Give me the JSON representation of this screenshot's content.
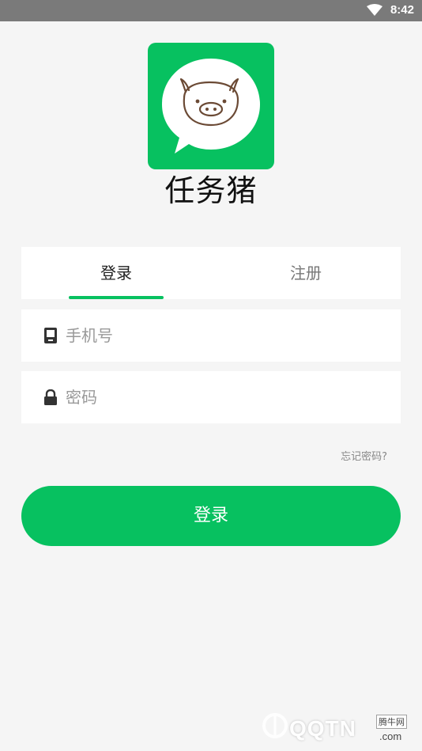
{
  "status_bar": {
    "time": "8:42",
    "icons": [
      "wifi-icon"
    ],
    "background_color": "#7a7a7a"
  },
  "app": {
    "name": "任务猪",
    "logo_icon": "pig-face-icon",
    "brand_color": "#07c160"
  },
  "tabs": [
    {
      "label": "登录",
      "active": true
    },
    {
      "label": "注册",
      "active": false
    }
  ],
  "form": {
    "phone": {
      "placeholder": "手机号",
      "value": "",
      "icon": "phone-icon"
    },
    "password": {
      "placeholder": "密码",
      "value": "",
      "icon": "lock-icon"
    },
    "forgot_label": "忘记密码?",
    "submit_label": "登录"
  },
  "watermark": {
    "main": "QQTN",
    "cn": "腾牛网",
    "suffix": ".com"
  }
}
